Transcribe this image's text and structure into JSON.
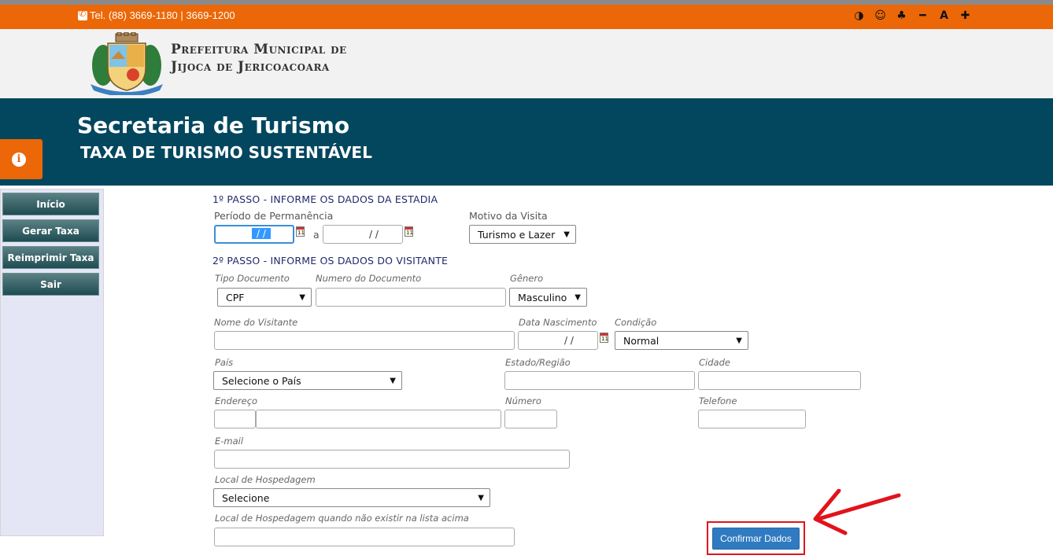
{
  "topbar": {
    "phone": "Tel. (88) 3669-1180 | 3669-1200",
    "accessibility": [
      "◑",
      "☺",
      "♣",
      "━",
      "A",
      "✚"
    ]
  },
  "logo": {
    "line1": "Prefeitura Municipal de",
    "line2": "Jijoca de Jericoacoara"
  },
  "banner": {
    "title": "Secretaria de Turismo",
    "subtitle": "TAXA DE TURISMO SUSTENTÁVEL"
  },
  "sidebar": {
    "items": [
      {
        "label": "Início"
      },
      {
        "label": "Gerar Taxa"
      },
      {
        "label": "Reimprimir Taxa"
      },
      {
        "label": "Sair"
      }
    ]
  },
  "step1": {
    "title": "1º PASSO - INFORME OS DADOS DA ESTADIA",
    "periodo_label": "Período de Permanência",
    "date_from": "/ /",
    "sep": "a",
    "date_to": "/ /",
    "motivo_label": "Motivo da Visita",
    "motivo_value": "Turismo e Lazer"
  },
  "step2": {
    "title": "2º PASSO - INFORME OS DADOS DO VISITANTE",
    "tipo_doc_label": "Tipo Documento",
    "tipo_doc_value": "CPF",
    "num_doc_label": "Numero do Documento",
    "genero_label": "Gênero",
    "genero_value": "Masculino",
    "nome_label": "Nome do Visitante",
    "nasc_label": "Data Nascimento",
    "nasc_value": "/ /",
    "condicao_label": "Condição",
    "condicao_value": "Normal",
    "pais_label": "País",
    "pais_value": "Selecione o País",
    "estado_label": "Estado/Região",
    "cidade_label": "Cidade",
    "endereco_label": "Endereço",
    "numero_label": "Número",
    "telefone_label": "Telefone",
    "email_label": "E-mail",
    "hosp_label": "Local de Hospedagem",
    "hosp_value": "Selecione",
    "hosp_alt_label": "Local de Hospedagem quando não existir na lista acima",
    "calendar_day": "11"
  },
  "actions": {
    "confirm_label": "Confirmar Dados"
  },
  "colors": {
    "orange": "#ec6707",
    "banner": "#03475f",
    "confirm": "#2f7ac0",
    "highlight": "#e0141a"
  }
}
